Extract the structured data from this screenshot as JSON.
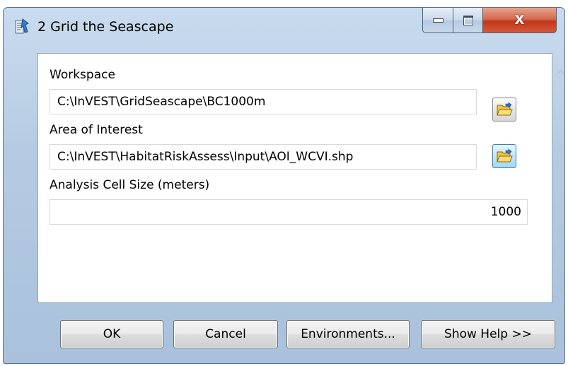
{
  "window": {
    "title": "2 Grid the Seascape",
    "controls": {
      "minimize": "minimize",
      "maximize": "maximize",
      "close": "X"
    }
  },
  "form": {
    "workspace": {
      "label": "Workspace",
      "value": "C:\\InVEST\\GridSeascape\\BC1000m"
    },
    "area_of_interest": {
      "label": "Area of Interest",
      "value": "C:\\InVEST\\HabitatRiskAssess\\Input\\AOI_WCVI.shp"
    },
    "cell_size": {
      "label": "Analysis Cell Size (meters)",
      "value": "1000"
    }
  },
  "buttons": {
    "ok": "OK",
    "cancel": "Cancel",
    "environments": "Environments...",
    "show_help": "Show Help >>"
  },
  "icons": {
    "app": "toolbox-script-icon",
    "browse": "open-folder-icon"
  },
  "colors": {
    "titlebar": "#b6cbe3",
    "close_button": "#c0381b",
    "active_browse": "#bee6fd"
  }
}
